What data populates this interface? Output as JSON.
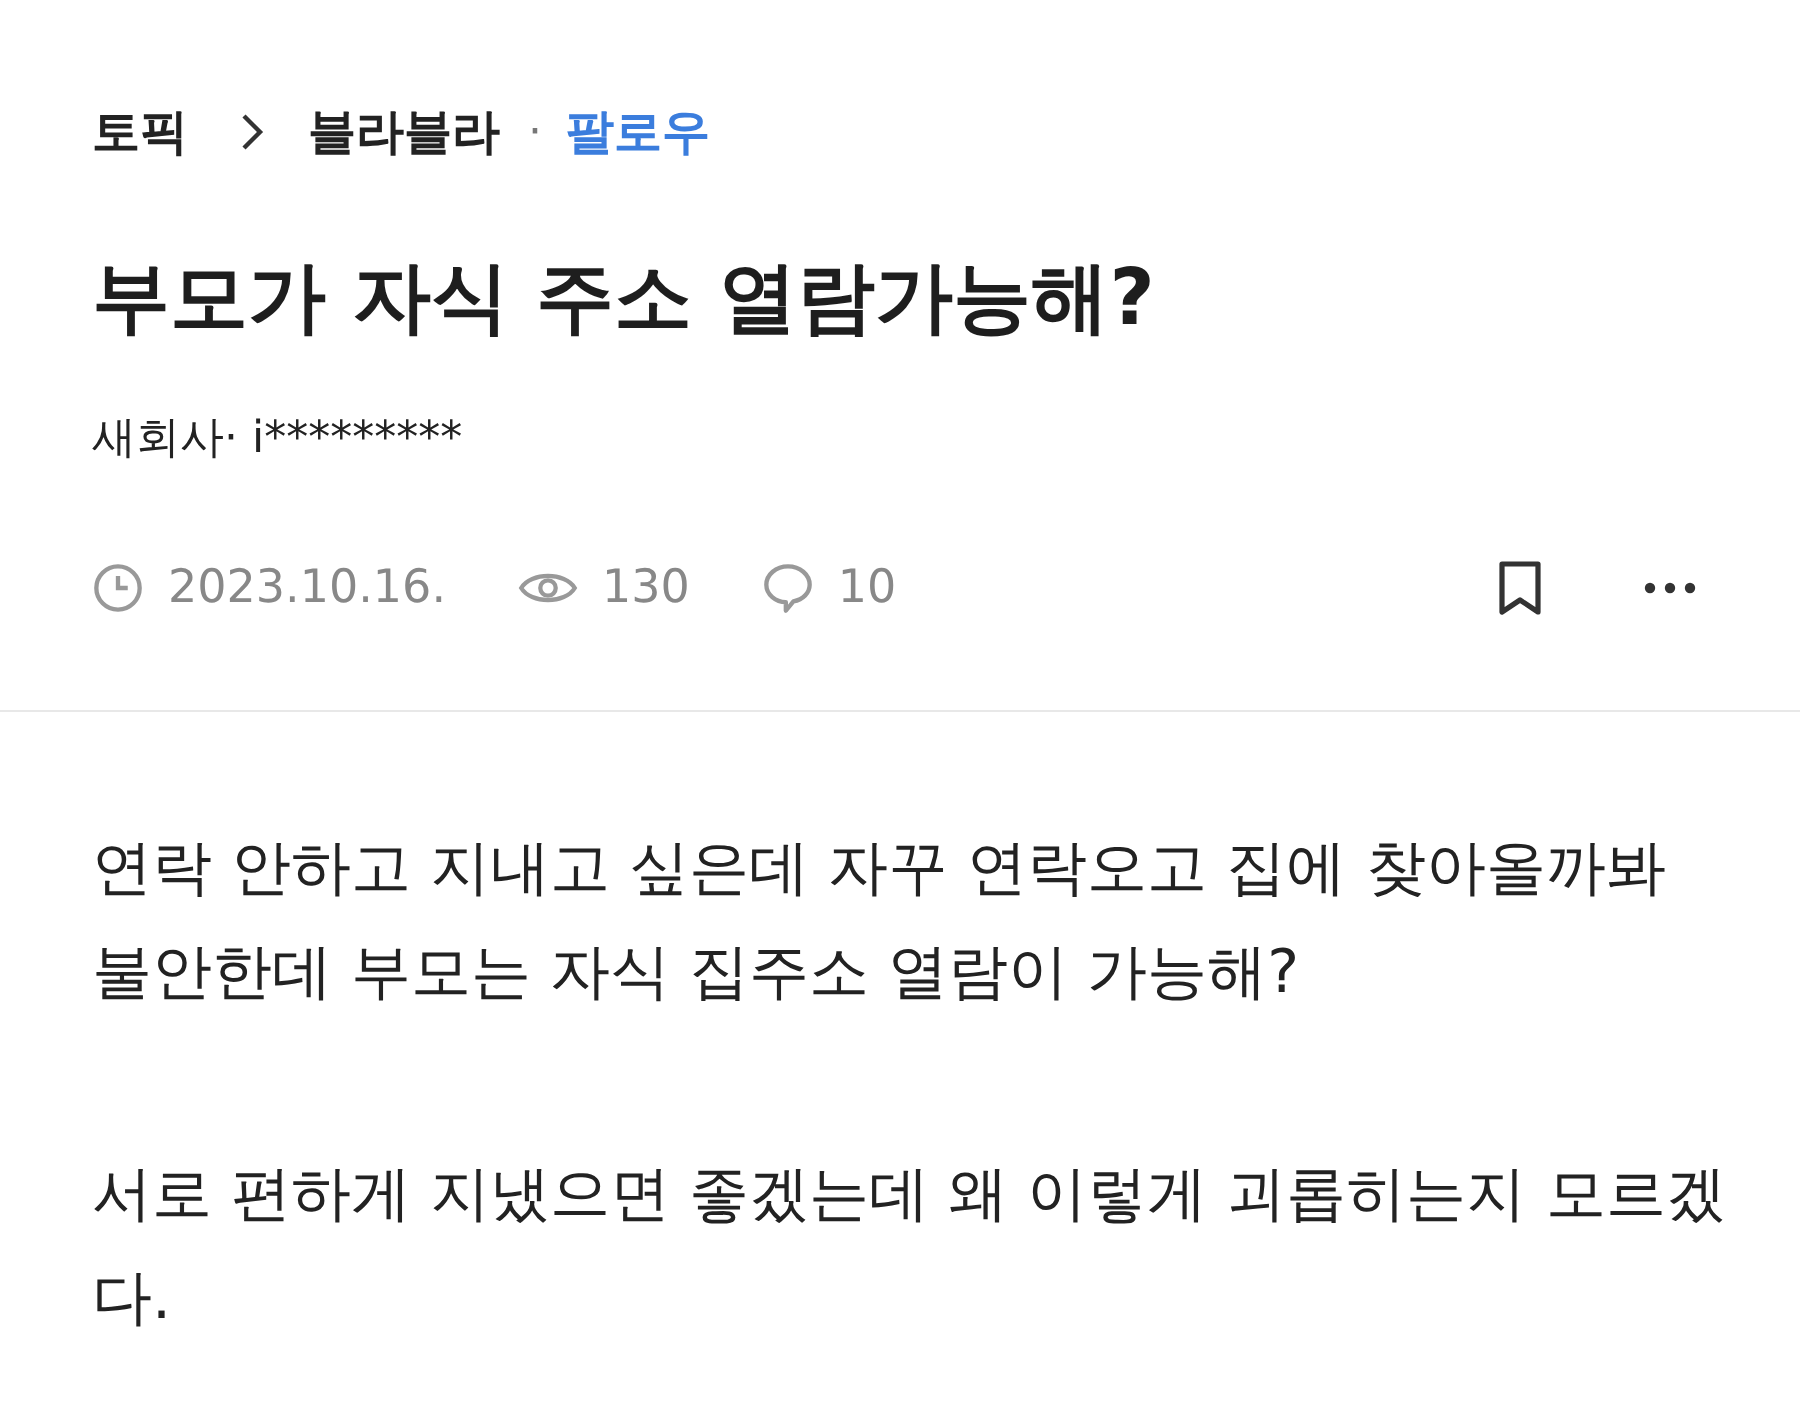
{
  "breadcrumb": {
    "root": "토픽",
    "board": "블라블라",
    "separator": "·",
    "follow": "팔로우"
  },
  "title": "부모가 자식 주소 열람가능해?",
  "author": "새회사· i*********",
  "meta": {
    "date": "2023.10.16.",
    "views": "130",
    "comments": "10",
    "bookmarked": false
  },
  "body": [
    "연락 안하고 지내고 싶은데 자꾸 연락오고 집에 찾아올까봐 불안한데 부모는 자식 집주소 열람이 가능해?",
    "서로 편하게 지냈으면 좋겠는데 왜 이렇게 괴롭히는지 모르겠다."
  ]
}
